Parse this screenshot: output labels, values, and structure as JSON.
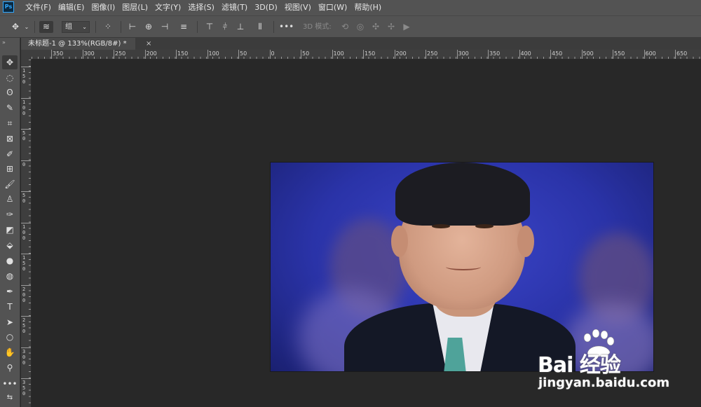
{
  "app": {
    "logo": "Ps"
  },
  "menu": [
    "文件(F)",
    "编辑(E)",
    "图像(I)",
    "图层(L)",
    "文字(Y)",
    "选择(S)",
    "滤镜(T)",
    "3D(D)",
    "视图(V)",
    "窗口(W)",
    "帮助(H)"
  ],
  "options": {
    "layer_select": "组",
    "mode_3d_label": "3D 模式:"
  },
  "document": {
    "tab_title": "未标题-1 @ 133%(RGB/8#) *",
    "close_glyph": "×"
  },
  "ruler": {
    "h_labels": [
      "350",
      "300",
      "250",
      "200",
      "150",
      "100",
      "50",
      "0",
      "50",
      "100",
      "150",
      "200",
      "250",
      "300",
      "350",
      "400",
      "450",
      "500",
      "550",
      "600",
      "650"
    ],
    "v_labels": [
      "150",
      "100",
      "50",
      "0",
      "50",
      "100",
      "150",
      "200",
      "250",
      "300",
      "350"
    ]
  },
  "watermark": {
    "brand": "Bai  经验",
    "url": "jingyan.baidu.com"
  }
}
